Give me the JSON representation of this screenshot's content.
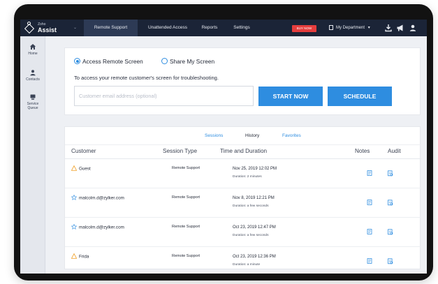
{
  "app": {
    "logo_small": "Zoho",
    "logo_name": "Assist"
  },
  "topbar": {
    "tabs": [
      {
        "label": "Remote Support",
        "active": true
      },
      {
        "label": "Unattended Access",
        "active": false
      },
      {
        "label": "Reports",
        "active": false
      },
      {
        "label": "Settings",
        "active": false
      }
    ],
    "buy_now": "BUY NOW",
    "department": "My Department",
    "icons": [
      "chevron-down-icon",
      "building-icon",
      "download-icon",
      "megaphone-icon",
      "user-icon"
    ]
  },
  "sidebar": {
    "items": [
      {
        "label": "Home",
        "icon": "home-icon"
      },
      {
        "label": "Contacts",
        "icon": "contacts-icon"
      },
      {
        "label": "Service Queue",
        "icon": "queue-icon"
      }
    ]
  },
  "session_start": {
    "option_access": "Access Remote Screen",
    "option_share": "Share My Screen",
    "selected": "Access Remote Screen",
    "description": "To access your remote customer's screen for troubleshooting.",
    "email_placeholder": "Customer email address (optional)",
    "start_label": "START NOW",
    "schedule_label": "SCHEDULE"
  },
  "history": {
    "tabs": [
      {
        "label": "Sessions",
        "active": false
      },
      {
        "label": "History",
        "active": true
      },
      {
        "label": "Favorites",
        "active": false
      }
    ],
    "columns": [
      "Customer",
      "Session Type",
      "Time and Duration",
      "Notes",
      "Audit"
    ],
    "rows": [
      {
        "customer": "Guest",
        "icon": "warning-icon",
        "type": "Remote Support",
        "time": "Nov 25, 2019 12:02 PM",
        "duration": "Duration: 2 minutes"
      },
      {
        "customer": "malcolm.d@zylker.com",
        "icon": "star-icon",
        "type": "Remote Support",
        "time": "Nov 8, 2019 12:21 PM",
        "duration": "Duration: a few seconds"
      },
      {
        "customer": "malcolm.d@zylker.com",
        "icon": "star-icon",
        "type": "Remote Support",
        "time": "Oct 23, 2019 12:47 PM",
        "duration": "Duration: a few seconds"
      },
      {
        "customer": "Frida",
        "icon": "warning-icon",
        "type": "Remote Support",
        "time": "Oct 23, 2019 12:36 PM",
        "duration": "Duration: a minute"
      }
    ]
  },
  "colors": {
    "topbar": "#1b2437",
    "accent": "#2e8de0",
    "buy_now": "#e53d3d",
    "warning": "#f2a93b"
  }
}
